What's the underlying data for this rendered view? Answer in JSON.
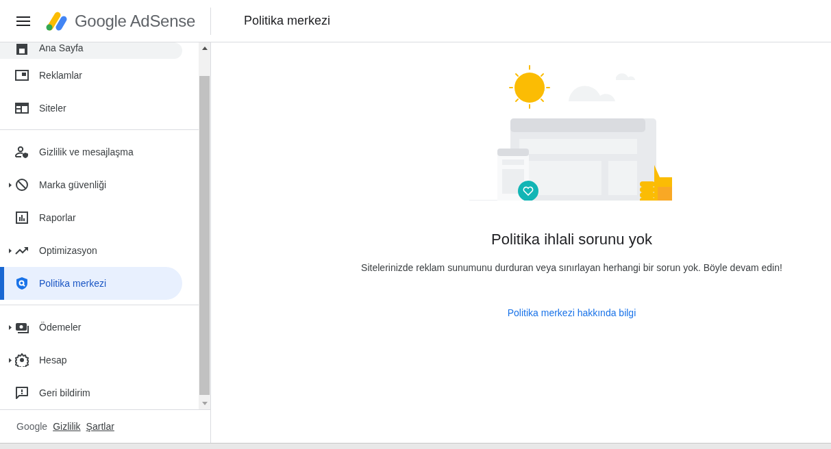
{
  "header": {
    "product": "Google AdSense",
    "page_title": "Politika merkezi"
  },
  "sidebar": {
    "sections": [
      {
        "items": [
          {
            "label": "Ana Sayfa",
            "expandable": false,
            "selected": false,
            "hovered": true
          },
          {
            "label": "Reklamlar",
            "expandable": false,
            "selected": false,
            "hovered": false
          },
          {
            "label": "Siteler",
            "expandable": false,
            "selected": false,
            "hovered": false
          }
        ]
      },
      {
        "items": [
          {
            "label": "Gizlilik ve mesajlaşma",
            "expandable": false,
            "selected": false,
            "hovered": false
          },
          {
            "label": "Marka güvenliği",
            "expandable": true,
            "selected": false,
            "hovered": false
          },
          {
            "label": "Raporlar",
            "expandable": false,
            "selected": false,
            "hovered": false
          },
          {
            "label": "Optimizasyon",
            "expandable": true,
            "selected": false,
            "hovered": false
          },
          {
            "label": "Politika merkezi",
            "expandable": false,
            "selected": true,
            "hovered": false
          }
        ]
      },
      {
        "items": [
          {
            "label": "Ödemeler",
            "expandable": true,
            "selected": false,
            "hovered": false
          },
          {
            "label": "Hesap",
            "expandable": true,
            "selected": false,
            "hovered": false
          },
          {
            "label": "Geri bildirim",
            "expandable": false,
            "selected": false,
            "hovered": false
          }
        ]
      }
    ],
    "footer": {
      "brand": "Google",
      "links": [
        "Gizlilik",
        "Şartlar"
      ]
    }
  },
  "main": {
    "heading": "Politika ihlali sorunu yok",
    "message": "Sitelerinizde reklam sunumunu durduran veya sınırlayan herhangi bir sorun yok. Böyle devam edin!",
    "link": "Politika merkezi hakkında bilgi"
  }
}
